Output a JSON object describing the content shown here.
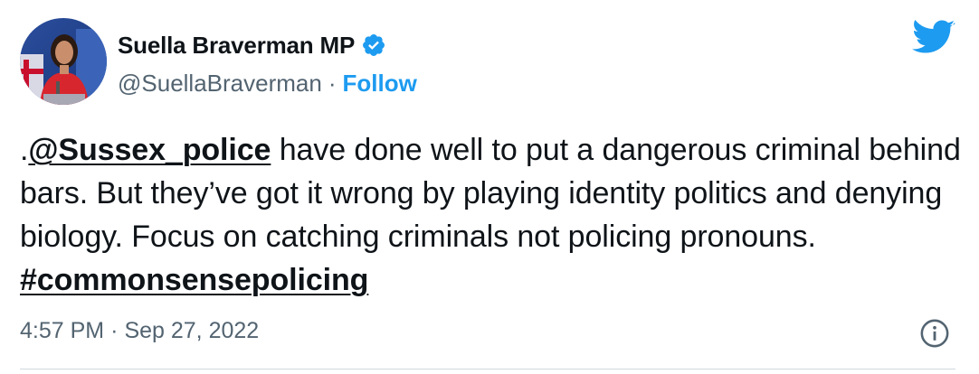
{
  "author": {
    "display_name": "Suella Braverman MP",
    "handle": "@SuellaBraverman",
    "separator": "·",
    "follow_label": "Follow",
    "verified": true
  },
  "tweet": {
    "prefix": ".",
    "mention": "@Sussex_police",
    "body": " have done well to put a dangerous criminal behind bars. But they’ve got it wrong by playing identity politics and denying biology. Focus on catching criminals not policing pronouns.  ",
    "hashtag": "#commonsensepolicing"
  },
  "meta": {
    "time": "4:57 PM",
    "separator": "·",
    "date": "Sep 27, 2022"
  },
  "icons": {
    "brand": "twitter-bird-icon",
    "verified": "verified-badge-icon",
    "info": "info-icon"
  },
  "colors": {
    "accent": "#1d9bf0",
    "text": "#0f1419",
    "muted": "#536471"
  }
}
